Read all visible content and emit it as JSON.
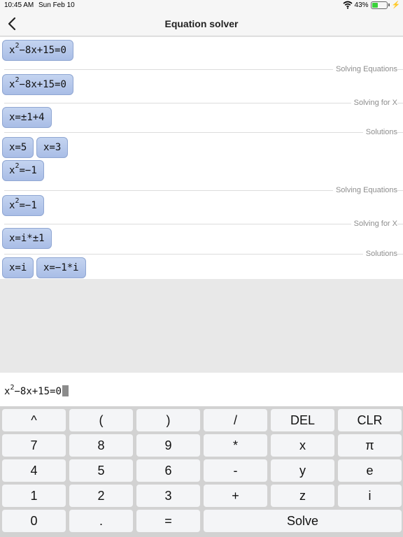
{
  "status": {
    "time": "10:45 AM",
    "date": "Sun Feb 10",
    "battery": "43%",
    "battery_level": 0.43
  },
  "nav": {
    "title": "Equation solver"
  },
  "history": {
    "problems": [
      {
        "original": {
          "base": "x",
          "exp": "2",
          "rest": "−8x+15=0"
        },
        "steps": [
          {
            "label": "Solving Equations",
            "base": "x",
            "exp": "2",
            "rest": "−8x+15=0"
          },
          {
            "label": "Solving for X",
            "text": "x=±1+4"
          },
          {
            "label": "Solutions",
            "items": [
              "x=5",
              "x=3"
            ]
          }
        ]
      },
      {
        "original": {
          "base": "x",
          "exp": "2",
          "rest": "=−1"
        },
        "steps": [
          {
            "label": "Solving Equations",
            "base": "x",
            "exp": "2",
            "rest": "=−1"
          },
          {
            "label": "Solving for X",
            "text": "x=i*±1"
          },
          {
            "label": "Solutions",
            "items": [
              "x=i",
              "x=−1*i"
            ]
          }
        ]
      }
    ]
  },
  "input": {
    "base": "x",
    "exp": "2",
    "rest": "−8x+15=0"
  },
  "keypad": {
    "rows": [
      [
        "^",
        "(",
        ")",
        "/",
        "DEL",
        "CLR"
      ],
      [
        "7",
        "8",
        "9",
        "*",
        "x",
        "π"
      ],
      [
        "4",
        "5",
        "6",
        "-",
        "y",
        "e"
      ],
      [
        "1",
        "2",
        "3",
        "+",
        "z",
        "i"
      ],
      [
        "0",
        ".",
        "=",
        "Solve"
      ]
    ]
  },
  "icons": [
    "back-chevron-icon",
    "wifi-icon",
    "battery-icon",
    "charging-bolt-icon"
  ],
  "colors": {
    "chip": "#b6c8ec",
    "chip_border": "#8fa6d2",
    "battery": "#3bd13b"
  }
}
